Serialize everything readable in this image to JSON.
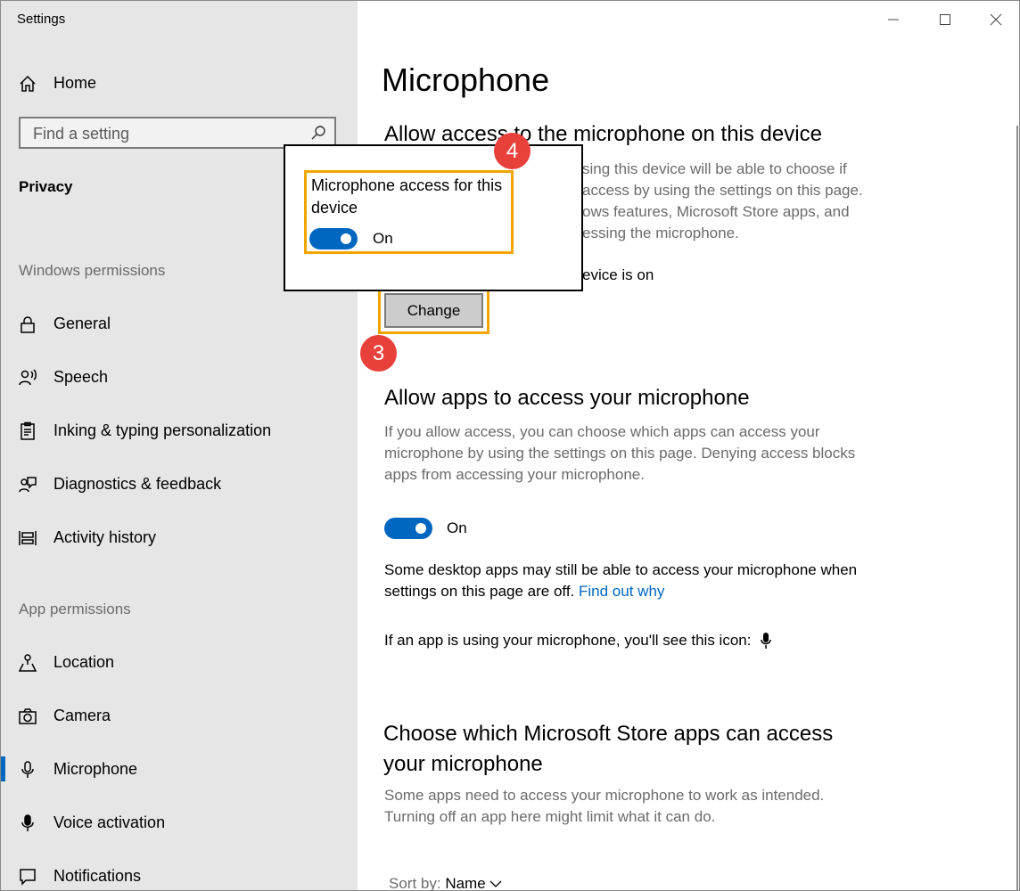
{
  "window": {
    "title": "Settings"
  },
  "sidebar": {
    "home_label": "Home",
    "search_placeholder": "Find a setting",
    "current_section": "Privacy",
    "windows_permissions_heading": "Windows permissions",
    "windows_permissions": [
      {
        "label": "General",
        "icon": "lock-icon"
      },
      {
        "label": "Speech",
        "icon": "speech-icon"
      },
      {
        "label": "Inking & typing personalization",
        "icon": "clipboard-icon"
      },
      {
        "label": "Diagnostics & feedback",
        "icon": "feedback-icon"
      },
      {
        "label": "Activity history",
        "icon": "timeline-icon"
      }
    ],
    "app_permissions_heading": "App permissions",
    "app_permissions": [
      {
        "label": "Location",
        "icon": "location-icon"
      },
      {
        "label": "Camera",
        "icon": "camera-icon"
      },
      {
        "label": "Microphone",
        "icon": "microphone-icon",
        "selected": true
      },
      {
        "label": "Voice activation",
        "icon": "voice-activation-icon"
      },
      {
        "label": "Notifications",
        "icon": "notifications-icon"
      }
    ]
  },
  "main": {
    "title": "Microphone",
    "device_section": {
      "heading": "Allow access to the microphone on this device",
      "description_visible": [
        "sing this device will be able to choose if",
        "access by using the settings on this page.",
        "ows features, Microsoft Store apps, and",
        "essing the microphone."
      ],
      "status_visible": "evice is on",
      "change_label": "Change"
    },
    "apps_section": {
      "heading": "Allow apps to access your microphone",
      "description": "If you allow access, you can choose which apps can access your microphone by using the settings on this page. Denying access blocks apps from accessing your microphone.",
      "toggle_state": "On",
      "note": "Some desktop apps may still be able to access your microphone when settings on this page are off.",
      "link": "Find out why",
      "icon_note": "If an app is using your microphone, you'll see this icon:"
    },
    "store_section": {
      "heading_line1": "Choose which Microsoft Store apps can access",
      "heading_line2": "your microphone",
      "description": "Some apps need to access your microphone to work as intended. Turning off an app here might limit what it can do.",
      "sort_label": "Sort by:",
      "sort_value": "Name"
    }
  },
  "popup": {
    "title": "Microphone access for this device",
    "toggle_state": "On"
  },
  "annotations": {
    "step_change": "3",
    "step_popup": "4"
  },
  "colors": {
    "accent": "#0067c0",
    "highlight": "#f0a500",
    "badge": "#e8413c"
  }
}
